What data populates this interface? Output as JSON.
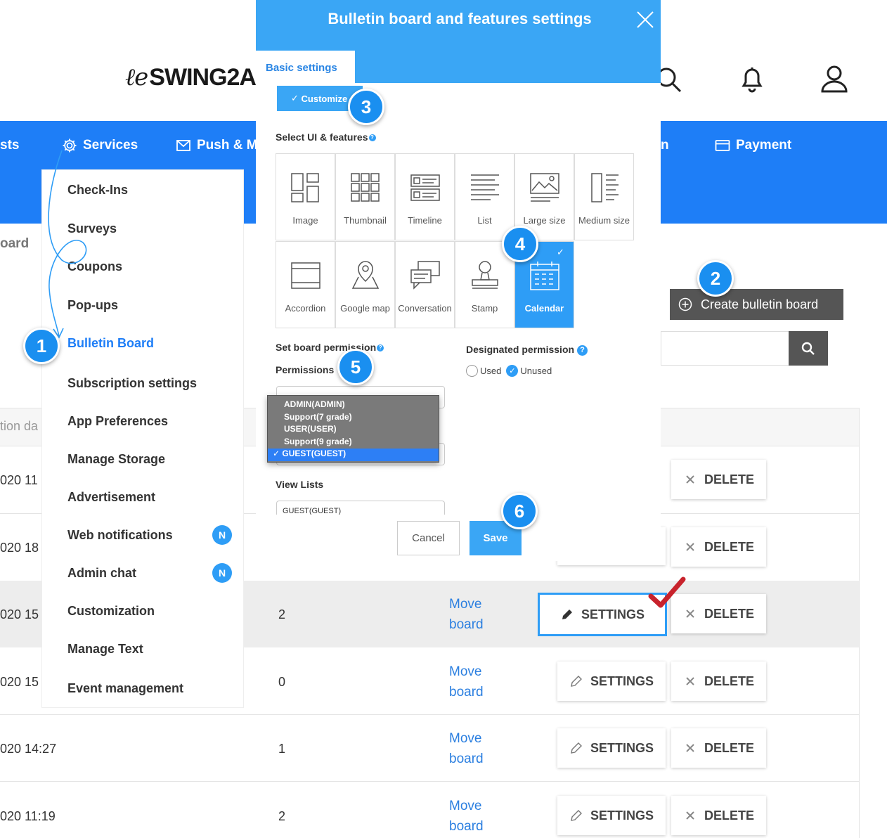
{
  "header": {
    "logo_text": "SWING2A"
  },
  "nav": {
    "left_fragment": "sts",
    "services": "Services",
    "push": "Push & Me",
    "right_fragment": "n",
    "payment": "Payment"
  },
  "dropdown": {
    "items": [
      "Check-Ins",
      "Surveys",
      "Coupons",
      "Pop-ups",
      "Bulletin Board",
      "Subscription settings",
      "App Preferences",
      "Manage Storage",
      "Advertisement",
      "Web notifications",
      "Admin chat",
      "Customization",
      "Manage Text",
      "Event management"
    ],
    "badge": "N"
  },
  "page": {
    "breadcrumb_fragment": "oard",
    "col_header_fragment": "tion da",
    "create_button": "Create bulletin board"
  },
  "table": {
    "rows": [
      {
        "date": "020 11",
        "count": "",
        "move": "",
        "board": ""
      },
      {
        "date": "020 18",
        "count": "",
        "move": "",
        "board": ""
      },
      {
        "date": "020 15",
        "count": "2",
        "move": "Move",
        "board": "board"
      },
      {
        "date": "020 15",
        "count": "0",
        "move": "Move",
        "board": "board"
      },
      {
        "date": "020 14:27",
        "count": "1",
        "move": "Move",
        "board": "board"
      },
      {
        "date": "020 11:19",
        "count": "2",
        "move": "Move",
        "board": "board"
      }
    ],
    "settings_label": "SETTINGS",
    "delete_label": "DELETE"
  },
  "modal": {
    "title": "Bulletin board and features settings",
    "tab": "Basic settings",
    "customize": "Customize",
    "select_ui": "Select UI & features",
    "tiles": [
      "Image",
      "Thumbnail",
      "Timeline",
      "List",
      "Large size",
      "Medium size",
      "Accordion",
      "Google map",
      "Conversation",
      "Stamp",
      "Calendar"
    ],
    "set_permission": "Set board permission",
    "permissions": "Permissions",
    "designated": "Designated permission",
    "used": "Used",
    "unused": "Unused",
    "options": [
      "ADMIN(ADMIN)",
      "Support(7 grade)",
      "USER(USER)",
      "Support(9 grade)",
      "GUEST(GUEST)"
    ],
    "view_lists": "View Lists",
    "view_value": "GUEST(GUEST)",
    "cancel": "Cancel",
    "save": "Save"
  },
  "steps": [
    "1",
    "2",
    "3",
    "4",
    "5",
    "6"
  ],
  "colors": {
    "nav_blue": "#1e7ef7",
    "modal_blue": "#3aa6f5",
    "accent": "#2e9df6",
    "check_red": "#c8232c"
  }
}
